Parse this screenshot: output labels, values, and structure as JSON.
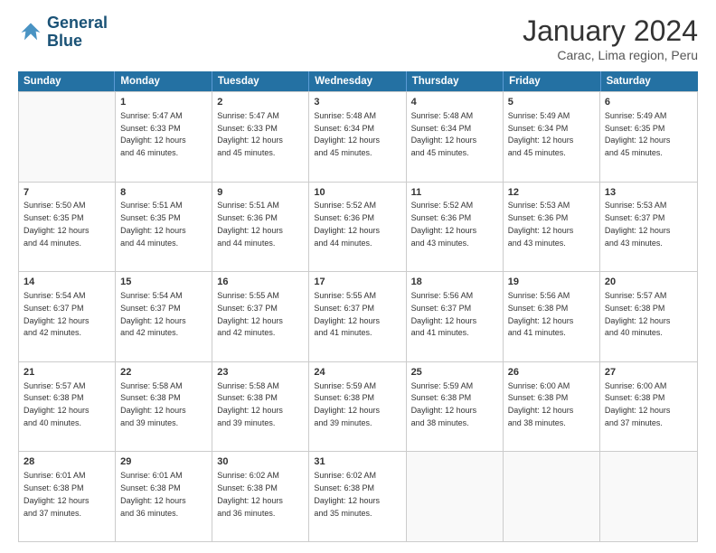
{
  "header": {
    "logo_line1": "General",
    "logo_line2": "Blue",
    "month_title": "January 2024",
    "subtitle": "Carac, Lima region, Peru"
  },
  "weekdays": [
    "Sunday",
    "Monday",
    "Tuesday",
    "Wednesday",
    "Thursday",
    "Friday",
    "Saturday"
  ],
  "weeks": [
    [
      {
        "day": "",
        "empty": true
      },
      {
        "day": "1",
        "sunrise": "Sunrise: 5:47 AM",
        "sunset": "Sunset: 6:33 PM",
        "daylight": "Daylight: 12 hours",
        "daylight2": "and 46 minutes."
      },
      {
        "day": "2",
        "sunrise": "Sunrise: 5:47 AM",
        "sunset": "Sunset: 6:33 PM",
        "daylight": "Daylight: 12 hours",
        "daylight2": "and 45 minutes."
      },
      {
        "day": "3",
        "sunrise": "Sunrise: 5:48 AM",
        "sunset": "Sunset: 6:34 PM",
        "daylight": "Daylight: 12 hours",
        "daylight2": "and 45 minutes."
      },
      {
        "day": "4",
        "sunrise": "Sunrise: 5:48 AM",
        "sunset": "Sunset: 6:34 PM",
        "daylight": "Daylight: 12 hours",
        "daylight2": "and 45 minutes."
      },
      {
        "day": "5",
        "sunrise": "Sunrise: 5:49 AM",
        "sunset": "Sunset: 6:34 PM",
        "daylight": "Daylight: 12 hours",
        "daylight2": "and 45 minutes."
      },
      {
        "day": "6",
        "sunrise": "Sunrise: 5:49 AM",
        "sunset": "Sunset: 6:35 PM",
        "daylight": "Daylight: 12 hours",
        "daylight2": "and 45 minutes."
      }
    ],
    [
      {
        "day": "7",
        "sunrise": "Sunrise: 5:50 AM",
        "sunset": "Sunset: 6:35 PM",
        "daylight": "Daylight: 12 hours",
        "daylight2": "and 44 minutes."
      },
      {
        "day": "8",
        "sunrise": "Sunrise: 5:51 AM",
        "sunset": "Sunset: 6:35 PM",
        "daylight": "Daylight: 12 hours",
        "daylight2": "and 44 minutes."
      },
      {
        "day": "9",
        "sunrise": "Sunrise: 5:51 AM",
        "sunset": "Sunset: 6:36 PM",
        "daylight": "Daylight: 12 hours",
        "daylight2": "and 44 minutes."
      },
      {
        "day": "10",
        "sunrise": "Sunrise: 5:52 AM",
        "sunset": "Sunset: 6:36 PM",
        "daylight": "Daylight: 12 hours",
        "daylight2": "and 44 minutes."
      },
      {
        "day": "11",
        "sunrise": "Sunrise: 5:52 AM",
        "sunset": "Sunset: 6:36 PM",
        "daylight": "Daylight: 12 hours",
        "daylight2": "and 43 minutes."
      },
      {
        "day": "12",
        "sunrise": "Sunrise: 5:53 AM",
        "sunset": "Sunset: 6:36 PM",
        "daylight": "Daylight: 12 hours",
        "daylight2": "and 43 minutes."
      },
      {
        "day": "13",
        "sunrise": "Sunrise: 5:53 AM",
        "sunset": "Sunset: 6:37 PM",
        "daylight": "Daylight: 12 hours",
        "daylight2": "and 43 minutes."
      }
    ],
    [
      {
        "day": "14",
        "sunrise": "Sunrise: 5:54 AM",
        "sunset": "Sunset: 6:37 PM",
        "daylight": "Daylight: 12 hours",
        "daylight2": "and 42 minutes."
      },
      {
        "day": "15",
        "sunrise": "Sunrise: 5:54 AM",
        "sunset": "Sunset: 6:37 PM",
        "daylight": "Daylight: 12 hours",
        "daylight2": "and 42 minutes."
      },
      {
        "day": "16",
        "sunrise": "Sunrise: 5:55 AM",
        "sunset": "Sunset: 6:37 PM",
        "daylight": "Daylight: 12 hours",
        "daylight2": "and 42 minutes."
      },
      {
        "day": "17",
        "sunrise": "Sunrise: 5:55 AM",
        "sunset": "Sunset: 6:37 PM",
        "daylight": "Daylight: 12 hours",
        "daylight2": "and 41 minutes."
      },
      {
        "day": "18",
        "sunrise": "Sunrise: 5:56 AM",
        "sunset": "Sunset: 6:37 PM",
        "daylight": "Daylight: 12 hours",
        "daylight2": "and 41 minutes."
      },
      {
        "day": "19",
        "sunrise": "Sunrise: 5:56 AM",
        "sunset": "Sunset: 6:38 PM",
        "daylight": "Daylight: 12 hours",
        "daylight2": "and 41 minutes."
      },
      {
        "day": "20",
        "sunrise": "Sunrise: 5:57 AM",
        "sunset": "Sunset: 6:38 PM",
        "daylight": "Daylight: 12 hours",
        "daylight2": "and 40 minutes."
      }
    ],
    [
      {
        "day": "21",
        "sunrise": "Sunrise: 5:57 AM",
        "sunset": "Sunset: 6:38 PM",
        "daylight": "Daylight: 12 hours",
        "daylight2": "and 40 minutes."
      },
      {
        "day": "22",
        "sunrise": "Sunrise: 5:58 AM",
        "sunset": "Sunset: 6:38 PM",
        "daylight": "Daylight: 12 hours",
        "daylight2": "and 39 minutes."
      },
      {
        "day": "23",
        "sunrise": "Sunrise: 5:58 AM",
        "sunset": "Sunset: 6:38 PM",
        "daylight": "Daylight: 12 hours",
        "daylight2": "and 39 minutes."
      },
      {
        "day": "24",
        "sunrise": "Sunrise: 5:59 AM",
        "sunset": "Sunset: 6:38 PM",
        "daylight": "Daylight: 12 hours",
        "daylight2": "and 39 minutes."
      },
      {
        "day": "25",
        "sunrise": "Sunrise: 5:59 AM",
        "sunset": "Sunset: 6:38 PM",
        "daylight": "Daylight: 12 hours",
        "daylight2": "and 38 minutes."
      },
      {
        "day": "26",
        "sunrise": "Sunrise: 6:00 AM",
        "sunset": "Sunset: 6:38 PM",
        "daylight": "Daylight: 12 hours",
        "daylight2": "and 38 minutes."
      },
      {
        "day": "27",
        "sunrise": "Sunrise: 6:00 AM",
        "sunset": "Sunset: 6:38 PM",
        "daylight": "Daylight: 12 hours",
        "daylight2": "and 37 minutes."
      }
    ],
    [
      {
        "day": "28",
        "sunrise": "Sunrise: 6:01 AM",
        "sunset": "Sunset: 6:38 PM",
        "daylight": "Daylight: 12 hours",
        "daylight2": "and 37 minutes."
      },
      {
        "day": "29",
        "sunrise": "Sunrise: 6:01 AM",
        "sunset": "Sunset: 6:38 PM",
        "daylight": "Daylight: 12 hours",
        "daylight2": "and 36 minutes."
      },
      {
        "day": "30",
        "sunrise": "Sunrise: 6:02 AM",
        "sunset": "Sunset: 6:38 PM",
        "daylight": "Daylight: 12 hours",
        "daylight2": "and 36 minutes."
      },
      {
        "day": "31",
        "sunrise": "Sunrise: 6:02 AM",
        "sunset": "Sunset: 6:38 PM",
        "daylight": "Daylight: 12 hours",
        "daylight2": "and 35 minutes."
      },
      {
        "day": "",
        "empty": true
      },
      {
        "day": "",
        "empty": true
      },
      {
        "day": "",
        "empty": true
      }
    ]
  ]
}
